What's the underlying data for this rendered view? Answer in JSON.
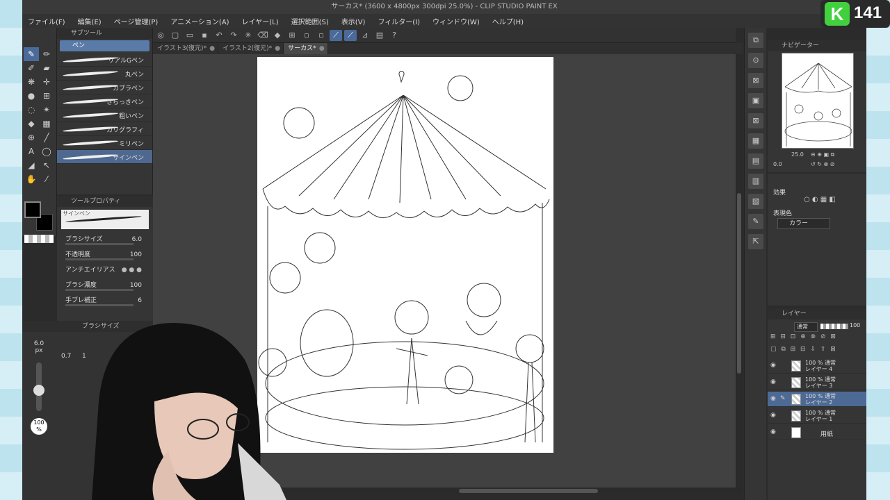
{
  "window": {
    "title": "サーカス* (3600 x 4800px 300dpi 25.0%)  - CLIP STUDIO PAINT EX"
  },
  "menu": [
    "ファイル(F)",
    "編集(E)",
    "ページ管理(P)",
    "アニメーション(A)",
    "レイヤー(L)",
    "選択範囲(S)",
    "表示(V)",
    "フィルター(I)",
    "ウィンドウ(W)",
    "ヘルプ(H)"
  ],
  "subtool": {
    "header": "サブツール",
    "tab": "ペン",
    "brushes": [
      "リアルGペン",
      "丸ペン",
      "カブラペン",
      "さらっきペン",
      "粗いペン",
      "カリグラフィ",
      "ミリペン",
      "サインペン"
    ],
    "selected": "サインペン"
  },
  "toolprop": {
    "header": "ツールプロパティ",
    "brush_name": "サインペン",
    "rows": [
      {
        "label": "ブラシサイズ",
        "value": "6.0"
      },
      {
        "label": "不透明度",
        "value": "100"
      },
      {
        "label": "アンチエイリアス",
        "value": ""
      },
      {
        "label": "ブラシ濃度",
        "value": "100"
      },
      {
        "label": "手ブレ補正",
        "value": "6"
      }
    ]
  },
  "brushsize": {
    "header": "ブラシサイズ",
    "value": "6.0",
    "unit": "px",
    "sizes": [
      "0.7",
      "1"
    ],
    "opacity": "100",
    "opacity_unit": "%"
  },
  "tabs": [
    {
      "label": "イラスト3(復元)*",
      "active": false
    },
    {
      "label": "イラスト2(復元)*",
      "active": false
    },
    {
      "label": "サーカス*",
      "active": true
    }
  ],
  "navigator": {
    "header": "ナビゲーター",
    "zoom": "25.0",
    "angle": "0.0"
  },
  "effect": {
    "header": "効果",
    "display_color_label": "表現色",
    "display_color_value": "カラー"
  },
  "layers": {
    "header": "レイヤー",
    "blend": "通常",
    "opacity": "100",
    "items": [
      {
        "mode": "100 % 通常",
        "name": "レイヤー 4",
        "selected": false
      },
      {
        "mode": "100 % 通常",
        "name": "レイヤー 3",
        "selected": false
      },
      {
        "mode": "100 % 通常",
        "name": "レイヤー 2",
        "selected": true
      },
      {
        "mode": "100 % 通常",
        "name": "レイヤー 1",
        "selected": false
      },
      {
        "mode": "",
        "name": "用紙",
        "selected": false
      }
    ]
  },
  "overlay": {
    "badge_letter": "K",
    "badge_number": "141"
  },
  "colors": {
    "accent": "#4a6a9a",
    "badge_green": "#43d03f"
  }
}
